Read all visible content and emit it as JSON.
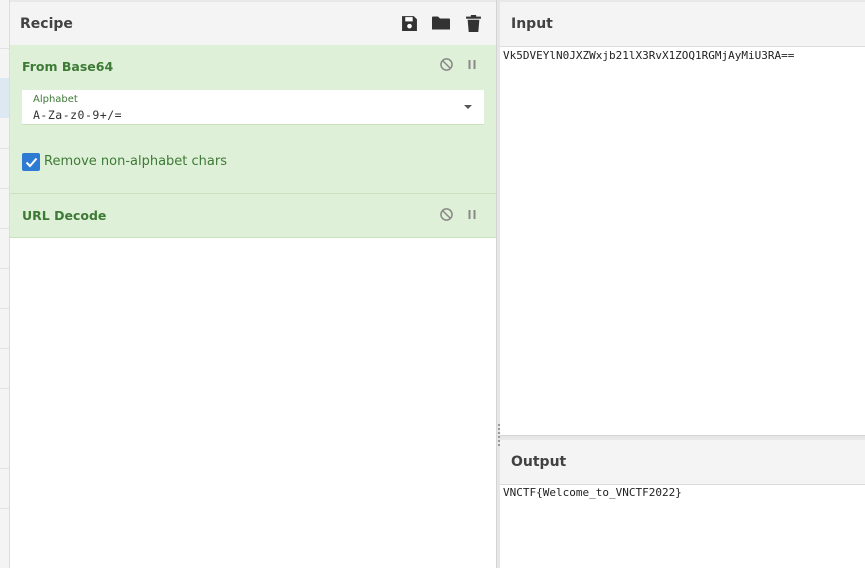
{
  "recipe": {
    "title": "Recipe",
    "header_icons": [
      "save-icon",
      "folder-icon",
      "trash-icon"
    ],
    "operations": [
      {
        "name": "From Base64",
        "alphabet_label": "Alphabet",
        "alphabet_value": "A-Za-z0-9+/=",
        "checkbox_label": "Remove non-alphabet chars",
        "checkbox_checked": true
      },
      {
        "name": "URL Decode"
      }
    ]
  },
  "input": {
    "title": "Input",
    "text": "Vk5DVEYlN0JXZWxjb21lX3RvX1ZOQ1RGMjAyMiU3RA=="
  },
  "output": {
    "title": "Output",
    "text": "VNCTF{Welcome_to_VNCTF2022}"
  },
  "colors": {
    "op_bg": "#dff0d8",
    "op_text": "#3d7a35",
    "checkbox": "#2f7bd4"
  }
}
